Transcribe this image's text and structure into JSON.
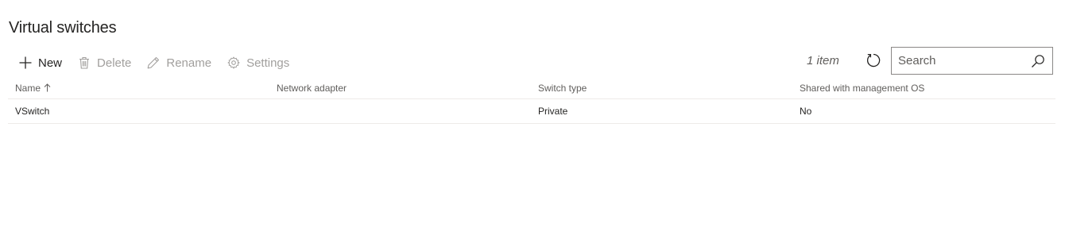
{
  "page": {
    "title": "Virtual switches"
  },
  "toolbar": {
    "new_label": "New",
    "delete_label": "Delete",
    "rename_label": "Rename",
    "settings_label": "Settings",
    "item_count": "1 item"
  },
  "search": {
    "placeholder": "Search",
    "value": ""
  },
  "table": {
    "columns": [
      "Name",
      "Network adapter",
      "Switch type",
      "Shared with management OS"
    ],
    "sort": {
      "column": "Name",
      "direction": "ascending"
    },
    "rows": [
      [
        "VSwitch",
        "",
        "Private",
        "No"
      ]
    ]
  },
  "icons": {
    "new": "plus-icon",
    "delete": "trash-icon",
    "rename": "pencil-icon",
    "settings": "gear-icon",
    "refresh": "refresh-icon",
    "search": "search-icon",
    "sort": "arrow-up-icon"
  },
  "colors": {
    "text": "#252423",
    "disabled": "#a19f9d",
    "secondary": "#605e5c",
    "border": "#8a8886",
    "divider": "#edebe9"
  }
}
